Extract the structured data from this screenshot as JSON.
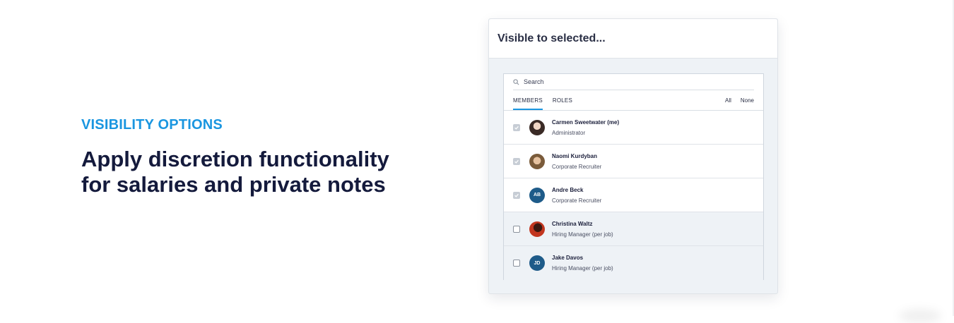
{
  "intro": {
    "eyebrow": "VISIBILITY OPTIONS",
    "headline": "Apply discretion functionality for salaries and private notes"
  },
  "card": {
    "title": "Visible to selected..."
  },
  "search": {
    "placeholder": "Search",
    "icon": "search-icon"
  },
  "tabs": {
    "members": "MEMBERS",
    "roles": "ROLES",
    "active": "MEMBERS"
  },
  "actions": {
    "all": "All",
    "none": "None"
  },
  "colors": {
    "accent": "#1a96e0",
    "headline": "#141a3c",
    "avatar_initials_bg": "#1e5b89"
  },
  "members": [
    {
      "name": "Carmen Sweetwater (me)",
      "role": "Administrator",
      "checked": true,
      "avatar": "photo"
    },
    {
      "name": "Naomi Kurdyban",
      "role": "Corporate Recruiter",
      "checked": true,
      "avatar": "photo"
    },
    {
      "name": "Andre Beck",
      "role": "Corporate Recruiter",
      "checked": true,
      "avatar": "AB"
    },
    {
      "name": "Christina Waltz",
      "role": "Hiring Manager (per job)",
      "checked": false,
      "avatar": "photo"
    },
    {
      "name": "Jake Davos",
      "role": "Hiring Manager (per job)",
      "checked": false,
      "avatar": "JD"
    }
  ]
}
